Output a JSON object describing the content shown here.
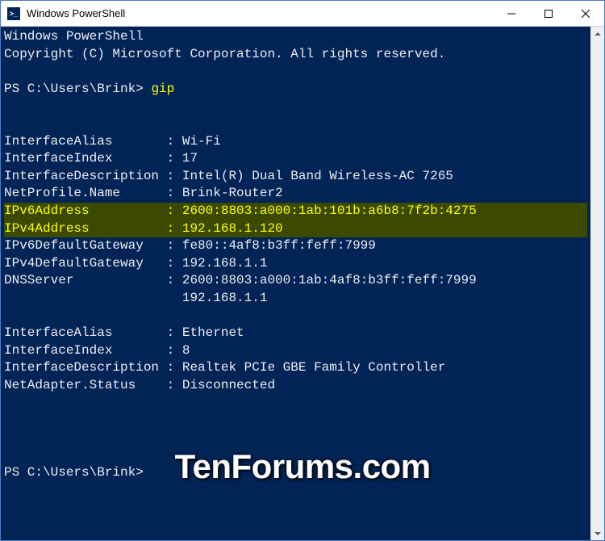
{
  "titlebar": {
    "icon_label": ">_",
    "title": "Windows PowerShell"
  },
  "terminal": {
    "header_line1": "Windows PowerShell",
    "header_line2": "Copyright (C) Microsoft Corporation. All rights reserved.",
    "prompt1": "PS C:\\Users\\Brink> ",
    "command": "gip",
    "iface1": {
      "alias": "InterfaceAlias       : Wi-Fi",
      "index": "InterfaceIndex       : 17",
      "desc": "InterfaceDescription : Intel(R) Dual Band Wireless-AC 7265",
      "profile": "NetProfile.Name      : Brink-Router2",
      "ipv6": "IPv6Address          : 2600:8803:a000:1ab:101b:a6b8:7f2b:4275",
      "ipv4": "IPv4Address          : 192.168.1.120",
      "ipv6gw": "IPv6DefaultGateway   : fe80::4af8:b3ff:feff:7999",
      "ipv4gw": "IPv4DefaultGateway   : 192.168.1.1",
      "dns1": "DNSServer            : 2600:8803:a000:1ab:4af8:b3ff:feff:7999",
      "dns2": "                       192.168.1.1"
    },
    "iface2": {
      "alias": "InterfaceAlias       : Ethernet",
      "index": "InterfaceIndex       : 8",
      "desc": "InterfaceDescription : Realtek PCIe GBE Family Controller",
      "status": "NetAdapter.Status    : Disconnected"
    },
    "prompt2": "PS C:\\Users\\Brink>"
  },
  "watermark": "TenForums.com"
}
